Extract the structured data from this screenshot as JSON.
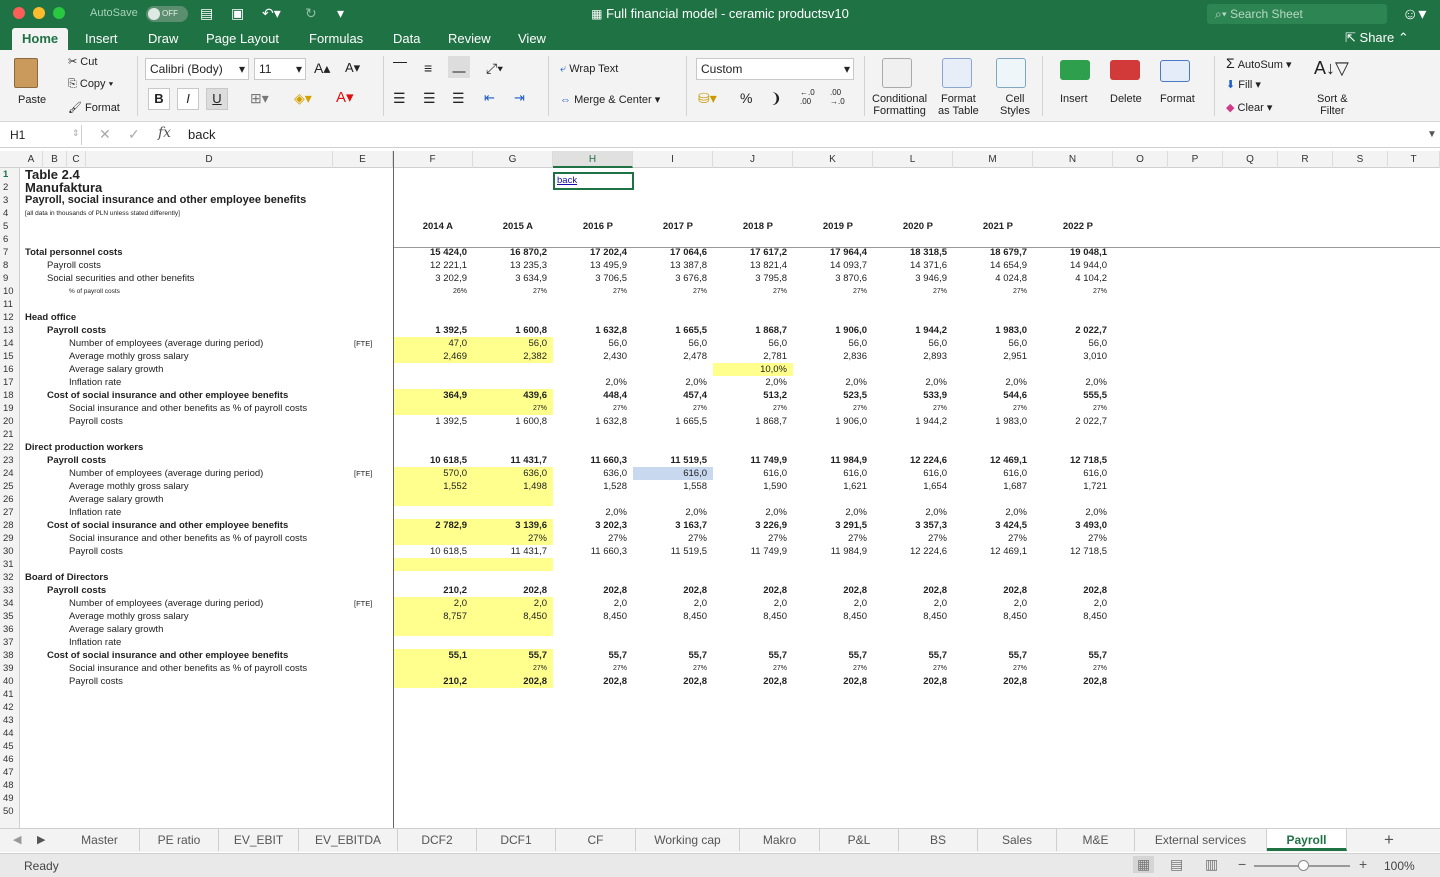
{
  "window": {
    "title": "Full financial model - ceramic productsv10",
    "autosave_label": "AutoSave",
    "autosave_state": "OFF",
    "search_placeholder": "Search Sheet"
  },
  "ribbon_tabs": [
    "Home",
    "Insert",
    "Draw",
    "Page Layout",
    "Formulas",
    "Data",
    "Review",
    "View"
  ],
  "share_label": "Share",
  "ribbon": {
    "paste": "Paste",
    "cut": "Cut",
    "copy": "Copy",
    "format_painter": "Format",
    "font_name": "Calibri (Body)",
    "font_size": "11",
    "wrap_text": "Wrap Text",
    "merge_center": "Merge & Center",
    "number_format": "Custom",
    "conditional": "Conditional",
    "formatting": "Formatting",
    "format_as": "Format",
    "as_table": "as Table",
    "cell": "Cell",
    "styles": "Styles",
    "insert": "Insert",
    "delete": "Delete",
    "format": "Format",
    "autosum": "AutoSum",
    "fill": "Fill",
    "clear": "Clear",
    "sort": "Sort &",
    "filter": "Filter",
    "bold": "B",
    "italic": "I",
    "underline": "U",
    "percent": "%"
  },
  "formula_bar": {
    "name_box": "H1",
    "value": "back"
  },
  "columns": [
    "A",
    "B",
    "C",
    "D",
    "E",
    "F",
    "G",
    "H",
    "I",
    "J",
    "K",
    "L",
    "M",
    "N",
    "O",
    "P",
    "Q",
    "R",
    "S",
    "T"
  ],
  "rows": {
    "1": {
      "label": "Table 2.4",
      "link": "back"
    },
    "2": {
      "label": "Manufaktura"
    },
    "3": {
      "label": "Payroll, social insurance and other employee benefits"
    },
    "4": {
      "label": "[all data in thousands of PLN unless stated differently]"
    },
    "5": {
      "years": [
        "2014 A",
        "2015 A",
        "2016 P",
        "2017 P",
        "2018 P",
        "2019 P",
        "2020 P",
        "2021 P",
        "2022 P"
      ]
    },
    "7": {
      "label": "Total personnel costs",
      "values": [
        "15 424,0",
        "16 870,2",
        "17 202,4",
        "17 064,6",
        "17 617,2",
        "17 964,4",
        "18 318,5",
        "18 679,7",
        "19 048,1"
      ]
    },
    "8": {
      "label": "Payroll costs",
      "values": [
        "12 221,1",
        "13 235,3",
        "13 495,9",
        "13 387,8",
        "13 821,4",
        "14 093,7",
        "14 371,6",
        "14 654,9",
        "14 944,0"
      ]
    },
    "9": {
      "label": "Social securities and other benefits",
      "values": [
        "3 202,9",
        "3 634,9",
        "3 706,5",
        "3 676,8",
        "3 795,8",
        "3 870,6",
        "3 946,9",
        "4 024,8",
        "4 104,2"
      ]
    },
    "10": {
      "label": "% of payroll costs",
      "values": [
        "26%",
        "27%",
        "27%",
        "27%",
        "27%",
        "27%",
        "27%",
        "27%",
        "27%"
      ]
    },
    "12": {
      "label": "Head office"
    },
    "13": {
      "label": "Payroll costs",
      "values": [
        "1 392,5",
        "1 600,8",
        "1 632,8",
        "1 665,5",
        "1 868,7",
        "1 906,0",
        "1 944,2",
        "1 983,0",
        "2 022,7"
      ]
    },
    "14": {
      "label": "Number of employees (average during period)",
      "unit": "[FTE]",
      "values": [
        "47,0",
        "56,0",
        "56,0",
        "56,0",
        "56,0",
        "56,0",
        "56,0",
        "56,0",
        "56,0"
      ]
    },
    "15": {
      "label": "Average mothly gross salary",
      "values": [
        "2,469",
        "2,382",
        "2,430",
        "2,478",
        "2,781",
        "2,836",
        "2,893",
        "2,951",
        "3,010"
      ]
    },
    "16": {
      "label": "Average salary growth",
      "values": [
        "",
        "",
        "",
        "",
        "10,0%",
        "",
        "",
        "",
        ""
      ]
    },
    "17": {
      "label": "Inflation rate",
      "values": [
        "",
        "",
        "2,0%",
        "2,0%",
        "2,0%",
        "2,0%",
        "2,0%",
        "2,0%",
        "2,0%"
      ]
    },
    "18": {
      "label": "Cost of social insurance and other employee benefits",
      "values": [
        "364,9",
        "439,6",
        "448,4",
        "457,4",
        "513,2",
        "523,5",
        "533,9",
        "544,6",
        "555,5"
      ]
    },
    "19": {
      "label": "Social insurance and other benefits as % of payroll costs",
      "values": [
        "",
        "27%",
        "27%",
        "27%",
        "27%",
        "27%",
        "27%",
        "27%",
        "27%"
      ]
    },
    "20": {
      "label": "Payroll costs",
      "values": [
        "1 392,5",
        "1 600,8",
        "1 632,8",
        "1 665,5",
        "1 868,7",
        "1 906,0",
        "1 944,2",
        "1 983,0",
        "2 022,7"
      ]
    },
    "22": {
      "label": "Direct production workers"
    },
    "23": {
      "label": "Payroll costs",
      "values": [
        "10 618,5",
        "11 431,7",
        "11 660,3",
        "11 519,5",
        "11 749,9",
        "11 984,9",
        "12 224,6",
        "12 469,1",
        "12 718,5"
      ]
    },
    "24": {
      "label": "Number of employees (average during period)",
      "unit": "[FTE]",
      "values": [
        "570,0",
        "636,0",
        "636,0",
        "616,0",
        "616,0",
        "616,0",
        "616,0",
        "616,0",
        "616,0"
      ]
    },
    "25": {
      "label": "Average mothly gross salary",
      "values": [
        "1,552",
        "1,498",
        "1,528",
        "1,558",
        "1,590",
        "1,621",
        "1,654",
        "1,687",
        "1,721"
      ]
    },
    "26": {
      "label": "Average salary growth"
    },
    "27": {
      "label": "Inflation rate",
      "values": [
        "",
        "",
        "2,0%",
        "2,0%",
        "2,0%",
        "2,0%",
        "2,0%",
        "2,0%",
        "2,0%"
      ]
    },
    "28": {
      "label": "Cost of social insurance and other employee benefits",
      "values": [
        "2 782,9",
        "3 139,6",
        "3 202,3",
        "3 163,7",
        "3 226,9",
        "3 291,5",
        "3 357,3",
        "3 424,5",
        "3 493,0"
      ]
    },
    "29": {
      "label": "Social insurance and other benefits as % of payroll costs",
      "values": [
        "",
        "27%",
        "27%",
        "27%",
        "27%",
        "27%",
        "27%",
        "27%",
        "27%"
      ]
    },
    "30": {
      "label": "Payroll costs",
      "values": [
        "10 618,5",
        "11 431,7",
        "11 660,3",
        "11 519,5",
        "11 749,9",
        "11 984,9",
        "12 224,6",
        "12 469,1",
        "12 718,5"
      ]
    },
    "32": {
      "label": "Board of Directors"
    },
    "33": {
      "label": "Payroll costs",
      "values": [
        "210,2",
        "202,8",
        "202,8",
        "202,8",
        "202,8",
        "202,8",
        "202,8",
        "202,8",
        "202,8"
      ]
    },
    "34": {
      "label": "Number of employees (average during period)",
      "unit": "[FTE]",
      "values": [
        "2,0",
        "2,0",
        "2,0",
        "2,0",
        "2,0",
        "2,0",
        "2,0",
        "2,0",
        "2,0"
      ]
    },
    "35": {
      "label": "Average mothly gross salary",
      "values": [
        "8,757",
        "8,450",
        "8,450",
        "8,450",
        "8,450",
        "8,450",
        "8,450",
        "8,450",
        "8,450"
      ]
    },
    "36": {
      "label": "Average salary growth"
    },
    "37": {
      "label": "Inflation rate"
    },
    "38": {
      "label": "Cost of social insurance and other employee benefits",
      "values": [
        "55,1",
        "55,7",
        "55,7",
        "55,7",
        "55,7",
        "55,7",
        "55,7",
        "55,7",
        "55,7"
      ]
    },
    "39": {
      "label": "Social insurance and other benefits as % of payroll costs",
      "values": [
        "",
        "27%",
        "27%",
        "27%",
        "27%",
        "27%",
        "27%",
        "27%",
        "27%"
      ]
    },
    "40": {
      "label": "Payroll costs",
      "values": [
        "210,2",
        "202,8",
        "202,8",
        "202,8",
        "202,8",
        "202,8",
        "202,8",
        "202,8",
        "202,8"
      ]
    }
  },
  "sheet_tabs": [
    "Master",
    "PE ratio",
    "EV_EBIT",
    "EV_EBITDA",
    "DCF2",
    "DCF1",
    "CF",
    "Working cap",
    "Makro",
    "P&L",
    "BS",
    "Sales",
    "M&E",
    "External services",
    "Payroll"
  ],
  "active_sheet": "Payroll",
  "status": {
    "text": "Ready",
    "zoom": "100%"
  },
  "colors": {
    "excel_green": "#1f7244",
    "input_yellow": "#ffff8e",
    "selection_blue": "#c7d8ef"
  }
}
